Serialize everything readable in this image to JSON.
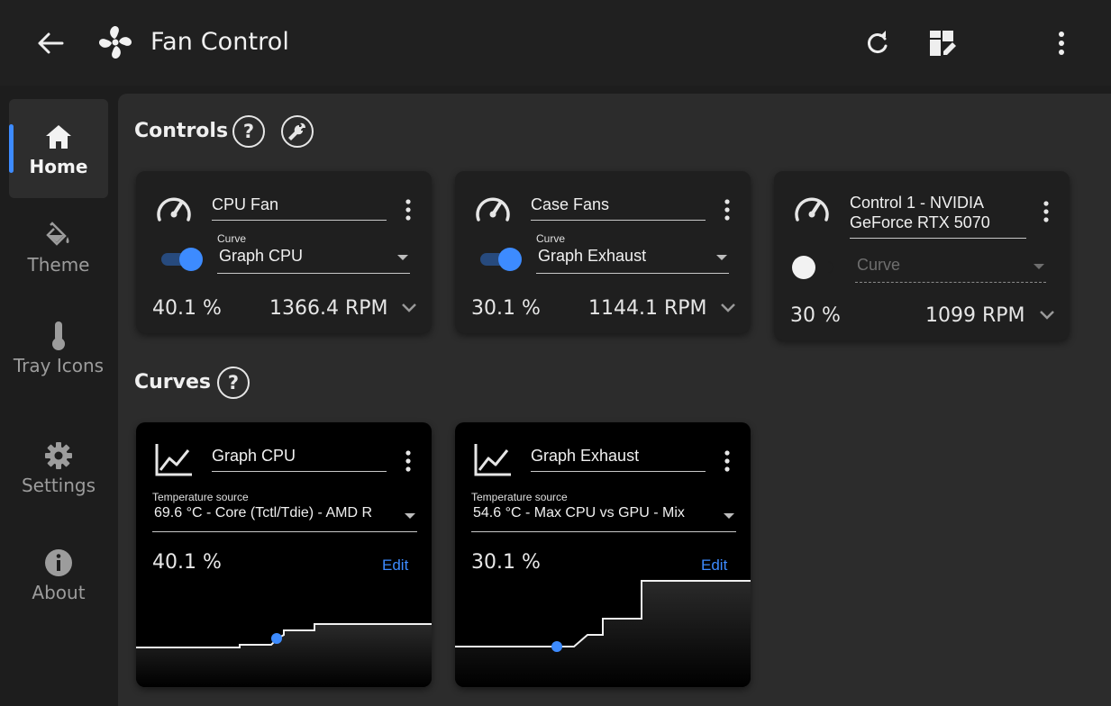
{
  "app": {
    "title": "Fan Control"
  },
  "toolbar": {
    "back_icon": "arrow-left-icon",
    "refresh_icon": "refresh-icon",
    "layout_edit_icon": "dashboard-edit-icon",
    "more_icon": "more-vertical-icon"
  },
  "sidebar": {
    "items": [
      {
        "label": "Home",
        "icon": "home-icon",
        "active": true
      },
      {
        "label": "Theme",
        "icon": "paint-bucket-icon",
        "active": false
      },
      {
        "label": "Tray Icons",
        "icon": "thermometer-icon",
        "active": false
      },
      {
        "label": "Settings",
        "icon": "gear-icon",
        "active": false
      },
      {
        "label": "About",
        "icon": "info-icon",
        "active": false
      }
    ]
  },
  "controls_section": {
    "title": "Controls",
    "help_icon": "help-icon",
    "tools_icon": "wrench-icon"
  },
  "controls": [
    {
      "name": "CPU Fan",
      "enabled": true,
      "curve_label": "Curve",
      "curve_value": "Graph CPU",
      "percent": "40.1 %",
      "rpm": "1366.4 RPM"
    },
    {
      "name": "Case Fans",
      "enabled": true,
      "curve_label": "Curve",
      "curve_value": "Graph Exhaust",
      "percent": "30.1 %",
      "rpm": "1144.1 RPM"
    },
    {
      "name": "Control 1 - NVIDIA GeForce RTX 5070",
      "enabled": false,
      "curve_label": "Curve",
      "curve_value": "",
      "percent": "30 %",
      "rpm": "1099 RPM"
    }
  ],
  "curves_section": {
    "title": "Curves",
    "help_icon": "help-icon"
  },
  "curves": [
    {
      "name": "Graph CPU",
      "source_label": "Temperature source",
      "source_value": "69.6 °C - Core (Tctl/Tdie) - AMD R",
      "percent": "40.1 %",
      "edit_label": "Edit"
    },
    {
      "name": "Graph Exhaust",
      "source_label": "Temperature source",
      "source_value": "54.6 °C - Max CPU vs GPU - Mix",
      "percent": "30.1 %",
      "edit_label": "Edit"
    }
  ],
  "colors": {
    "accent": "#3d8bff",
    "background": "#1d1d1d",
    "panel": "#2c2c2c",
    "card": "#1f1f1f"
  }
}
